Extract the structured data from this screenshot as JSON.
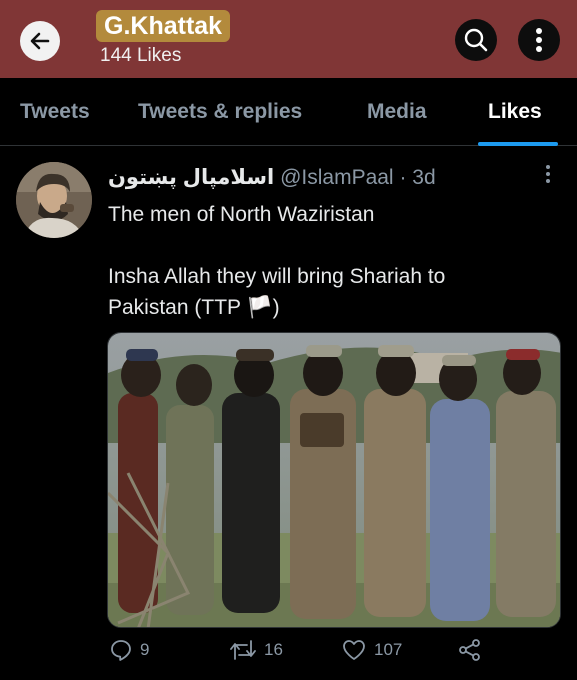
{
  "header": {
    "title": "G.Khattak",
    "subtitle": "144 Likes"
  },
  "tabs": [
    {
      "label": "Tweets"
    },
    {
      "label": "Tweets & replies"
    },
    {
      "label": "Media"
    },
    {
      "label": "Likes",
      "active": true
    }
  ],
  "tweet": {
    "display_name": "اسلامپال پښتون",
    "handle": "@IslamPaal",
    "separator": "·",
    "time": "3d",
    "text_line1": "The men of North Waziristan",
    "text_line2": "Insha Allah they will bring Shariah to",
    "text_line3": "Pakistan (TTP 🏳️)",
    "actions": {
      "replies": "9",
      "retweets": "16",
      "likes": "107"
    }
  },
  "colors": {
    "header_bg": "#803636",
    "title_highlight": "#b38a3c",
    "accent": "#1d9bf0",
    "muted": "#8b98a5"
  },
  "icons": [
    "back-arrow-icon",
    "search-icon",
    "more-vertical-icon",
    "reply-icon",
    "retweet-icon",
    "heart-icon",
    "share-icon"
  ]
}
